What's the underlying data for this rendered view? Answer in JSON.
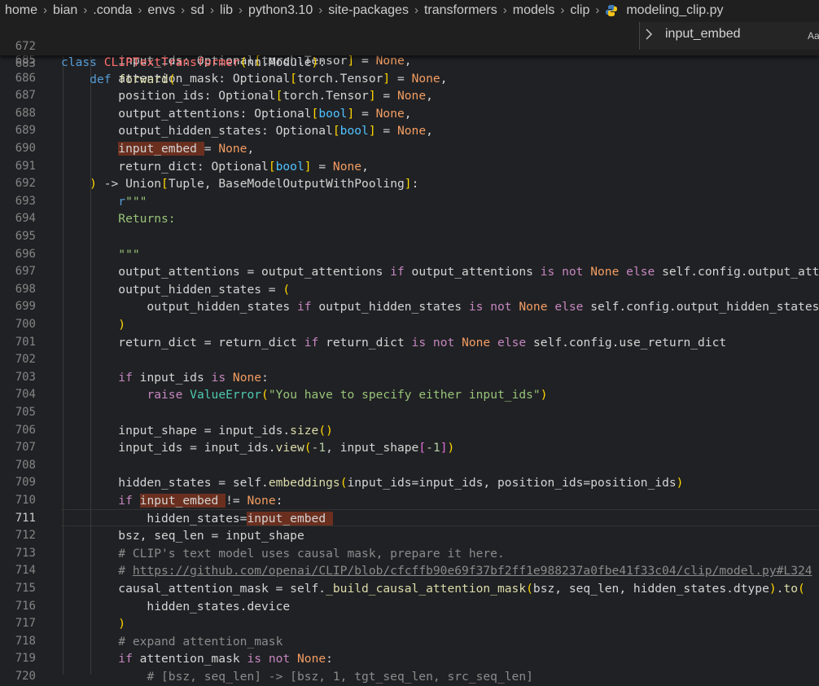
{
  "breadcrumb": [
    "home",
    "bian",
    ".conda",
    "envs",
    "sd",
    "lib",
    "python3.10",
    "site-packages",
    "transformers",
    "models",
    "clip",
    "modeling_clip.py"
  ],
  "find": {
    "query": "input_embed",
    "case_label": "Aa"
  },
  "sticky_lines": [
    {
      "no": "672",
      "text": "class CLIPTextTransformer(nn.Module):"
    },
    {
      "no": "683",
      "text": "    def forward("
    }
  ],
  "lines": [
    {
      "no": "685",
      "text": "        input_ids: Optional[torch.Tensor] = None,"
    },
    {
      "no": "686",
      "text": "        attention_mask: Optional[torch.Tensor] = None,"
    },
    {
      "no": "687",
      "text": "        position_ids: Optional[torch.Tensor] = None,"
    },
    {
      "no": "688",
      "text": "        output_attentions: Optional[bool] = None,"
    },
    {
      "no": "689",
      "text": "        output_hidden_states: Optional[bool] = None,"
    },
    {
      "no": "690",
      "text": "        input_embed = None,"
    },
    {
      "no": "691",
      "text": "        return_dict: Optional[bool] = None,"
    },
    {
      "no": "692",
      "text": "    ) -> Union[Tuple, BaseModelOutputWithPooling]:"
    },
    {
      "no": "693",
      "text": "        r\"\"\""
    },
    {
      "no": "694",
      "text": "        Returns:"
    },
    {
      "no": "695",
      "text": ""
    },
    {
      "no": "696",
      "text": "        \"\"\""
    },
    {
      "no": "697",
      "text": "        output_attentions = output_attentions if output_attentions is not None else self.config.output_atten"
    },
    {
      "no": "698",
      "text": "        output_hidden_states = ("
    },
    {
      "no": "699",
      "text": "            output_hidden_states if output_hidden_states is not None else self.config.output_hidden_states"
    },
    {
      "no": "700",
      "text": "        )"
    },
    {
      "no": "701",
      "text": "        return_dict = return_dict if return_dict is not None else self.config.use_return_dict"
    },
    {
      "no": "702",
      "text": ""
    },
    {
      "no": "703",
      "text": "        if input_ids is None:"
    },
    {
      "no": "704",
      "text": "            raise ValueError(\"You have to specify either input_ids\")"
    },
    {
      "no": "705",
      "text": ""
    },
    {
      "no": "706",
      "text": "        input_shape = input_ids.size()"
    },
    {
      "no": "707",
      "text": "        input_ids = input_ids.view(-1, input_shape[-1])"
    },
    {
      "no": "708",
      "text": ""
    },
    {
      "no": "709",
      "text": "        hidden_states = self.embeddings(input_ids=input_ids, position_ids=position_ids)"
    },
    {
      "no": "710",
      "text": "        if input_embed != None:"
    },
    {
      "no": "711",
      "text": "            hidden_states=input_embed"
    },
    {
      "no": "712",
      "text": "        bsz, seq_len = input_shape"
    },
    {
      "no": "713",
      "text": "        # CLIP's text model uses causal mask, prepare it here."
    },
    {
      "no": "714",
      "text": "        # https://github.com/openai/CLIP/blob/cfcffb90e69f37bf2ff1e988237a0fbe41f33c04/clip/model.py#L324"
    },
    {
      "no": "715",
      "text": "        causal_attention_mask = self._build_causal_attention_mask(bsz, seq_len, hidden_states.dtype).to("
    },
    {
      "no": "716",
      "text": "            hidden_states.device"
    },
    {
      "no": "717",
      "text": "        )"
    },
    {
      "no": "718",
      "text": "        # expand attention_mask"
    },
    {
      "no": "719",
      "text": "        if attention_mask is not None:"
    },
    {
      "no": "720",
      "text": "            # [bsz, seq_len] -> [bsz, 1, tgt_seq_len, src_seq_len]"
    }
  ],
  "active_line": "711",
  "colors": {
    "background": "#202124",
    "highlight": "#6b2f1f",
    "keyword": "#c586c0",
    "function": "#dcdcaa",
    "constant": "#f29d63"
  }
}
